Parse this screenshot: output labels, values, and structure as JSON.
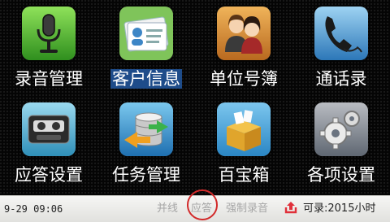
{
  "menu": {
    "items": [
      {
        "label": "录音管理",
        "icon": "microphone-icon"
      },
      {
        "label": "客户信息",
        "icon": "contact-cards-icon",
        "selected": true
      },
      {
        "label": "单位号簿",
        "icon": "people-icon"
      },
      {
        "label": "通话录",
        "icon": "phone-handset-icon"
      },
      {
        "label": "应答设置",
        "icon": "tape-cassette-icon"
      },
      {
        "label": "任务管理",
        "icon": "database-sync-icon"
      },
      {
        "label": "百宝箱",
        "icon": "treasure-box-icon"
      },
      {
        "label": "各项设置",
        "icon": "gears-icon"
      }
    ]
  },
  "status": {
    "datetime": "9-29 09:06",
    "modes": [
      "并线",
      "应答",
      "强制录音"
    ],
    "recordable_label": "可录:",
    "recordable_value": "2015",
    "recordable_unit": "小时",
    "colors": {
      "highlight_ring": "#d22a2a",
      "upload_icon": "#e0303a",
      "selection": "#1e4c8a"
    }
  }
}
